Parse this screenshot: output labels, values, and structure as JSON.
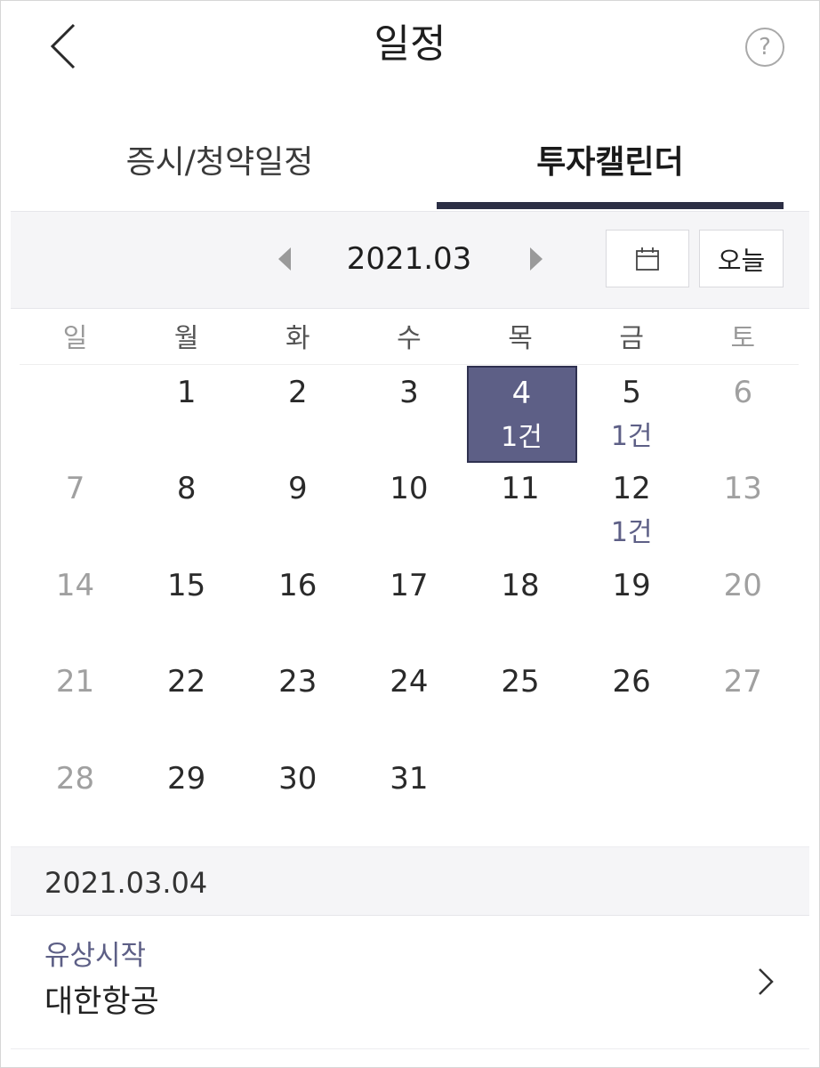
{
  "header": {
    "title": "일정",
    "help_symbol": "?",
    "icons": {
      "back": "chevron-left-icon",
      "help": "question-circle-icon"
    }
  },
  "tabs": [
    {
      "label": "증시/청약일정",
      "active": false
    },
    {
      "label": "투자캘린더",
      "active": true
    }
  ],
  "month_nav": {
    "month": "2021.03",
    "today_label": "오늘",
    "icons": {
      "prev": "triangle-left-icon",
      "next": "triangle-right-icon",
      "calendar": "calendar-icon"
    }
  },
  "weekdays": [
    "일",
    "월",
    "화",
    "수",
    "목",
    "금",
    "토"
  ],
  "calendar": {
    "accent_color": "#5d5f86",
    "selected_day": "4",
    "weeks": [
      [
        {
          "day": ""
        },
        {
          "day": "1"
        },
        {
          "day": "2"
        },
        {
          "day": "3"
        },
        {
          "day": "4",
          "count": "1건"
        },
        {
          "day": "5",
          "count": "1건"
        },
        {
          "day": "6"
        }
      ],
      [
        {
          "day": "7"
        },
        {
          "day": "8"
        },
        {
          "day": "9"
        },
        {
          "day": "10"
        },
        {
          "day": "11"
        },
        {
          "day": "12",
          "count": "1건"
        },
        {
          "day": "13"
        }
      ],
      [
        {
          "day": "14"
        },
        {
          "day": "15"
        },
        {
          "day": "16"
        },
        {
          "day": "17"
        },
        {
          "day": "18"
        },
        {
          "day": "19"
        },
        {
          "day": "20"
        }
      ],
      [
        {
          "day": "21"
        },
        {
          "day": "22"
        },
        {
          "day": "23"
        },
        {
          "day": "24"
        },
        {
          "day": "25"
        },
        {
          "day": "26"
        },
        {
          "day": "27"
        }
      ],
      [
        {
          "day": "28"
        },
        {
          "day": "29"
        },
        {
          "day": "30"
        },
        {
          "day": "31"
        },
        {
          "day": ""
        },
        {
          "day": ""
        },
        {
          "day": ""
        }
      ]
    ]
  },
  "selected_date": {
    "label": "2021.03.04",
    "events": [
      {
        "type": "유상시작",
        "name": "대한항공"
      }
    ],
    "icons": {
      "row": "chevron-right-icon"
    }
  }
}
